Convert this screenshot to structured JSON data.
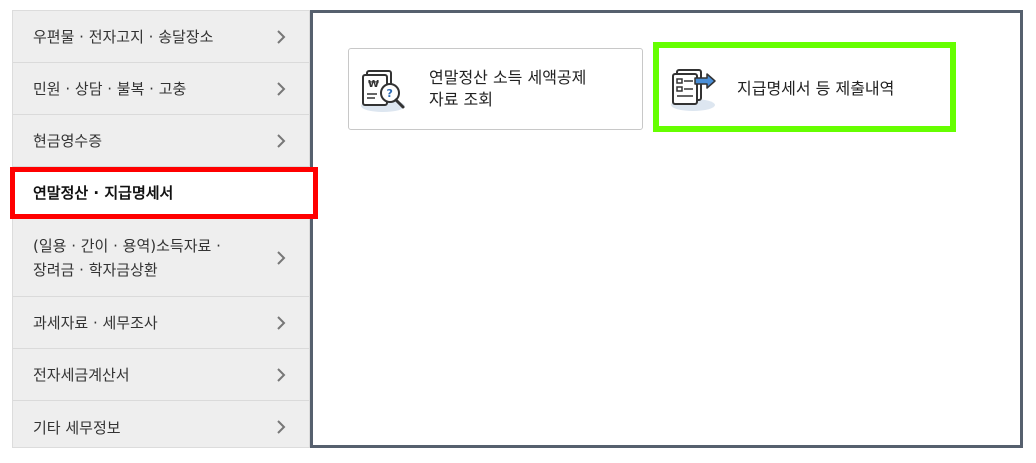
{
  "sidebar": {
    "items": [
      {
        "label": "우편물 · 전자고지 · 송달장소"
      },
      {
        "label": "민원 · 상담 · 불복 · 고충"
      },
      {
        "label": "현금영수증"
      },
      {
        "label": "연말정산 · 지급명세서"
      },
      {
        "label": "(일용 · 간이 · 용역)소득자료 ·\n장려금 · 학자금상환"
      },
      {
        "label": "과세자료 · 세무조사"
      },
      {
        "label": "전자세금계산서"
      },
      {
        "label": "기타 세무정보"
      }
    ],
    "active_index": 3,
    "chevron_icon": "chevron-right-icon"
  },
  "main": {
    "cards": [
      {
        "label": "연말정산 소득 세액공제\n자료 조회",
        "icon": "tax-document-search-icon"
      },
      {
        "label": "지급명세서 등 제출내역",
        "icon": "document-submit-icon"
      }
    ]
  },
  "colors": {
    "sidebar_bg": "#eeeeee",
    "active_highlight": "#ff0000",
    "card_highlight": "#66ff00",
    "panel_border": "#56606e",
    "icon_blue": "#2f6db5",
    "icon_bg": "#dde6f0"
  }
}
